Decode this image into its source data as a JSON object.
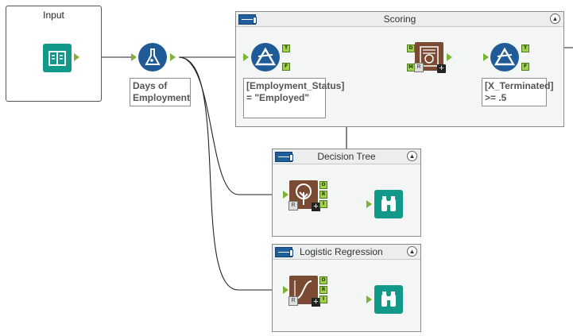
{
  "canvas": {
    "input_container": {
      "title": "Input"
    },
    "scoring_container": {
      "title": "Scoring"
    },
    "decision_tree_container": {
      "title": "Decision Tree"
    },
    "logistic_regression_container": {
      "title": "Logistic Regression"
    }
  },
  "annotations": {
    "formula": "Days of Employment",
    "filter_employed": "[Employment_Status] = \"Employed\"",
    "filter_terminated": "[X_Terminated] >= .5"
  },
  "anchor_labels": {
    "true": "T",
    "false": "F",
    "data": "D",
    "model": "M",
    "output": "O",
    "report": "R",
    "interactive": "I"
  },
  "colors": {
    "accent_blue": "#1f5c97",
    "teal": "#12998a",
    "brown": "#7b4a32",
    "anchor_green": "#a4d14d"
  }
}
